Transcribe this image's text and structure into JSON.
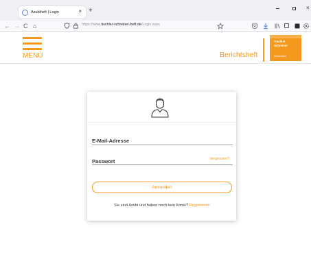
{
  "browser": {
    "tab_title": "Azubiheft | Login",
    "tab_close": "×",
    "new_tab": "+",
    "back": "←",
    "forward": "→",
    "reload": "C",
    "home": "⌂",
    "url_prefix": "https://www.",
    "url_domain": "tischler-schreiner-heft.de",
    "url_path": "/Login.aspx",
    "window_minimize": "−",
    "window_close": "×"
  },
  "header": {
    "menu_label": "MENÜ",
    "brand_title": "Berichtsheft",
    "logo_line1": "Tischler",
    "logo_line2": "Schreiner",
    "logo_sub": "Deutschland",
    "accent_color": "#f39a1e"
  },
  "login": {
    "email_label": "E-Mail-Adresse",
    "password_label": "Passwort",
    "forgot_link": "Vergessen?",
    "submit_label": "Anmelden",
    "register_prompt": "Sie sind Azubi und haben noch kein Konto? ",
    "register_link": "Registrieren"
  }
}
